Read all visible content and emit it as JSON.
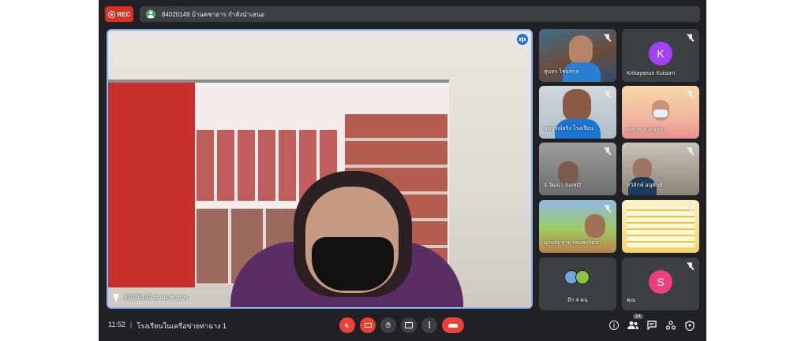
{
  "topbar": {
    "rec_label": "REC",
    "presenter_text": "84020149 บ้านคชาธาร กำลังนำเสนอ"
  },
  "main": {
    "label": "84020149 บ้านคชาธาร"
  },
  "tiles": [
    {
      "label": "สุนทร ไชยสกุล"
    },
    {
      "label": "Krittayanun Kuisorn",
      "avatar_letter": "K",
      "avatar_color": "#a142f4"
    },
    {
      "label": "สมบูรณ์จริง โรงเรียน"
    },
    {
      "label": "wisunun kraisit"
    },
    {
      "label": "3 วัฒนา Surat2"
    },
    {
      "label": "สวิลักษ์ อนุพันธ์"
    },
    {
      "label": "นายสมชาย เหมพรรัตนา"
    },
    {
      "label": ""
    },
    {
      "label": "อีก 4 คน"
    },
    {
      "label": "คุณ",
      "avatar_letter": "S",
      "avatar_color": "#ec407a"
    }
  ],
  "bottombar": {
    "time": "11:52",
    "separator": "|",
    "meeting_name": "โรงเรียนในเครือข่ายท่าฉาง 1",
    "participants_count": "14"
  },
  "colors": {
    "background": "#202124",
    "accent": "#8ab4f8",
    "danger": "#ea4335"
  }
}
